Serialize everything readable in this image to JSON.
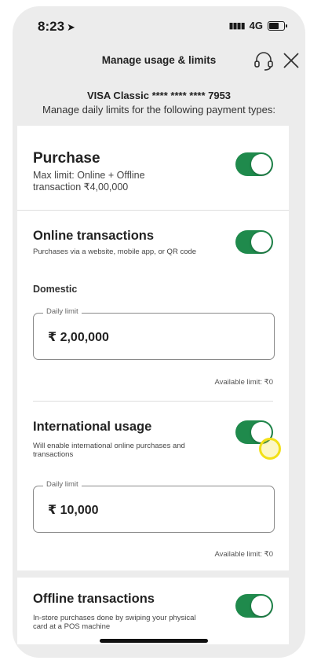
{
  "status_bar": {
    "time": "8:23",
    "network": "4G"
  },
  "header": {
    "title": "Manage usage & limits"
  },
  "card": {
    "name": "VISA Classic **** **** **** 7953",
    "subtitle": "Manage daily limits for the following payment types:"
  },
  "purchase": {
    "title": "Purchase",
    "desc": "Max limit: Online + Offline transaction ₹4,00,000",
    "enabled": true
  },
  "online": {
    "title": "Online transactions",
    "desc": "Purchases via a website, mobile app, or QR code",
    "enabled": true,
    "domestic_label": "Domestic",
    "daily_limit_label": "Daily limit",
    "daily_limit_value": "₹ 2,00,000",
    "available": "Available limit: ₹0"
  },
  "international": {
    "title": "International usage",
    "desc": "Will enable international online purchases and transactions",
    "enabled": true,
    "daily_limit_label": "Daily limit",
    "daily_limit_value": "₹ 10,000",
    "available": "Available limit: ₹0"
  },
  "offline": {
    "title": "Offline transactions",
    "desc": "In-store purchases done by swiping your physical card at a POS machine",
    "enabled": true
  },
  "colors": {
    "toggle_on": "#1f8a4c",
    "background": "#ececec",
    "tap_indicator": "#f2e016"
  }
}
